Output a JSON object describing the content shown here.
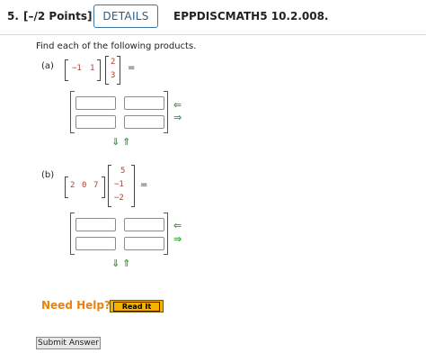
{
  "header": {
    "question_number": "5.",
    "points": "[–/2 Points]",
    "details_label": "DETAILS",
    "problem_code": "EPPDISCMATH5 10.2.008."
  },
  "prompt": "Find each of the following products.",
  "part_a": {
    "label": "(a)",
    "left_row": [
      "−1",
      "1"
    ],
    "right_col": [
      "2",
      "3"
    ],
    "equals": "="
  },
  "part_b": {
    "label": "(b)",
    "left_row": [
      "2",
      "0",
      "7"
    ],
    "right_col": [
      "5",
      "−1",
      "−2"
    ],
    "equals": "="
  },
  "answer_grid": {
    "rows": 2,
    "cols": 2,
    "arrow_left": "⇐",
    "arrow_right": "⇒",
    "arrow_down": "⇓",
    "arrow_up": "⇑"
  },
  "help": {
    "label": "Need Help?",
    "read_it_label": "Read It"
  },
  "submit_label": "Submit Answer",
  "colors": {
    "accent_blue": "#2a5f8b",
    "matrix_red": "#c0392b",
    "arrow_green": "#3aa53a",
    "help_orange": "#e8820e",
    "readit_bg": "#f5b000"
  }
}
